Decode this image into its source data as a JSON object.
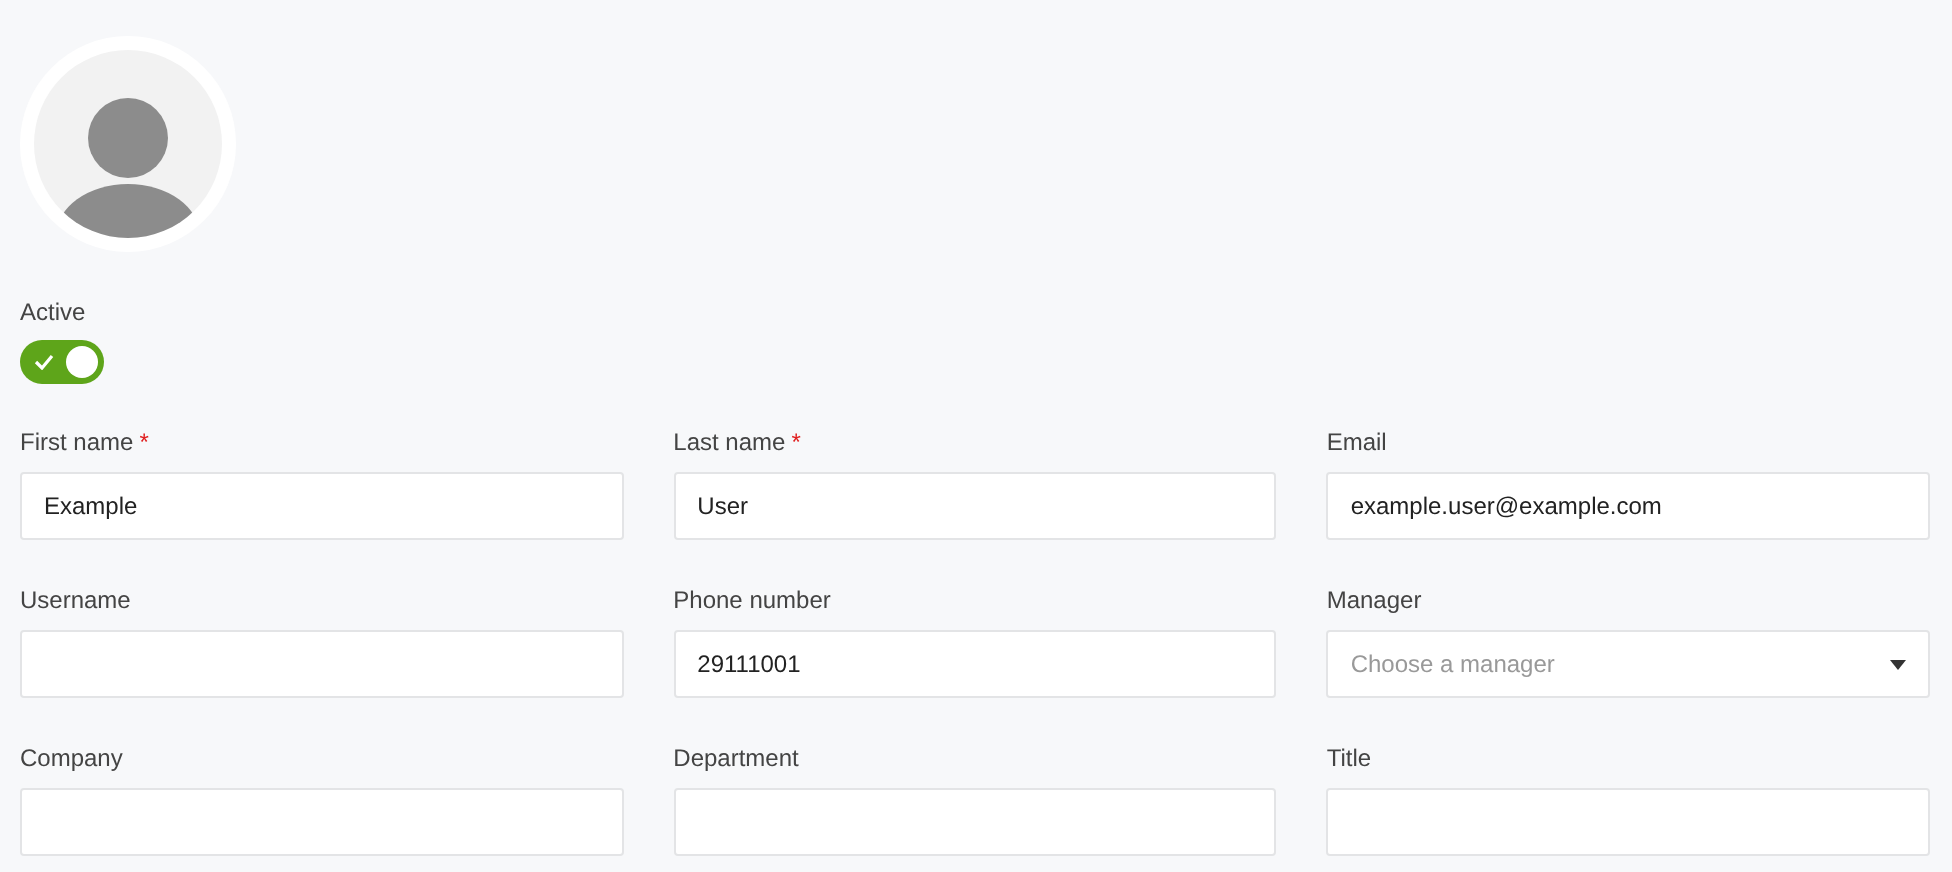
{
  "active": {
    "label": "Active",
    "on": true
  },
  "fields": [
    {
      "kind": "text",
      "label": "First name",
      "required_mark": "*",
      "value": "Example"
    },
    {
      "kind": "text",
      "label": "Last name",
      "required_mark": "*",
      "value": "User"
    },
    {
      "kind": "text",
      "label": "Email",
      "value": "example.user@example.com"
    },
    {
      "kind": "text",
      "label": "Username"
    },
    {
      "kind": "text",
      "label": "Phone number",
      "value": "29111001"
    },
    {
      "kind": "select",
      "label": "Manager",
      "placeholder": "Choose a manager"
    },
    {
      "kind": "text",
      "label": "Company"
    },
    {
      "kind": "text",
      "label": "Department"
    },
    {
      "kind": "text",
      "label": "Title"
    }
  ]
}
